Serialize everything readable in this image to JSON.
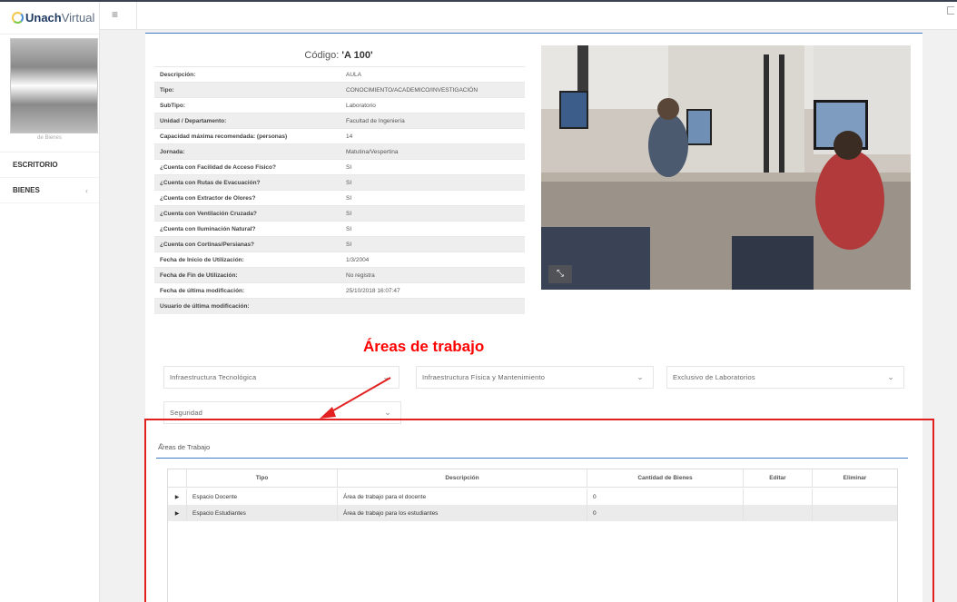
{
  "brand": {
    "name_bold": "Unach",
    "name_light": "Virtual"
  },
  "sidebar": {
    "avatar_caption": "de Bienes",
    "items": [
      {
        "label": "ESCRITORIO"
      },
      {
        "label": "BIENES",
        "chevron": "‹"
      }
    ]
  },
  "header": {
    "menu_icon": "≡"
  },
  "record": {
    "code_label": "Código:",
    "code_value": "'A 100'",
    "details": [
      {
        "label": "Descripción:",
        "value": "AULA"
      },
      {
        "label": "Tipo:",
        "value": "CONOCIMIENTO/ACADEMICO/INVESTIGACIÓN"
      },
      {
        "label": "SubTipo:",
        "value": "Laboratorio"
      },
      {
        "label": "Unidad / Departamento:",
        "value": "Facultad de Ingeniería"
      },
      {
        "label": "Capacidad máxima recomendada: (personas)",
        "value": "14"
      },
      {
        "label": "Jornada:",
        "value": "Matutina/Vespertina"
      },
      {
        "label": "¿Cuenta con Facilidad de Acceso Físico?",
        "value": "SI"
      },
      {
        "label": "¿Cuenta con Rutas de Evacuación?",
        "value": "SI"
      },
      {
        "label": "¿Cuenta con Extractor de Olores?",
        "value": "SI"
      },
      {
        "label": "¿Cuenta con Ventilación Cruzada?",
        "value": "SI"
      },
      {
        "label": "¿Cuenta con Iluminación Natural?",
        "value": "SI"
      },
      {
        "label": "¿Cuenta con Cortinas/Persianas?",
        "value": "SI"
      },
      {
        "label": "Fecha de Inicio de Utilización:",
        "value": "1/3/2004"
      },
      {
        "label": "Fecha de Fin de Utilización:",
        "value": "No registra"
      },
      {
        "label": "Fecha de última modificación:",
        "value": "25/10/2018 16:07:47"
      },
      {
        "label": "Usuario de última modificación:",
        "value": ""
      }
    ]
  },
  "annotation": {
    "title": "Áreas de trabajo",
    "color": "#ff0000"
  },
  "filters": [
    {
      "label": "Infraestructura Tecnológica"
    },
    {
      "label": "Infraestructura Física y Mantenimiento"
    },
    {
      "label": "Exclusivo de Laboratorios"
    },
    {
      "label": "Seguridad"
    }
  ],
  "work_areas": {
    "title": "Áreas de Trabajo",
    "columns": [
      "Tipo",
      "Descripción",
      "Cantidad de Bienes",
      "Editar",
      "Eliminar"
    ],
    "rows": [
      {
        "tipo": "Espacio Docente",
        "descripcion": "Área de trabajo para el docente",
        "cantidad": "0"
      },
      {
        "tipo": "Espacio Estudiantes",
        "descripcion": "Área de trabajo para los estudiantes",
        "cantidad": "0"
      }
    ]
  },
  "colors": {
    "accent": "#3d7bc2",
    "highlight_box": "#e32020"
  }
}
